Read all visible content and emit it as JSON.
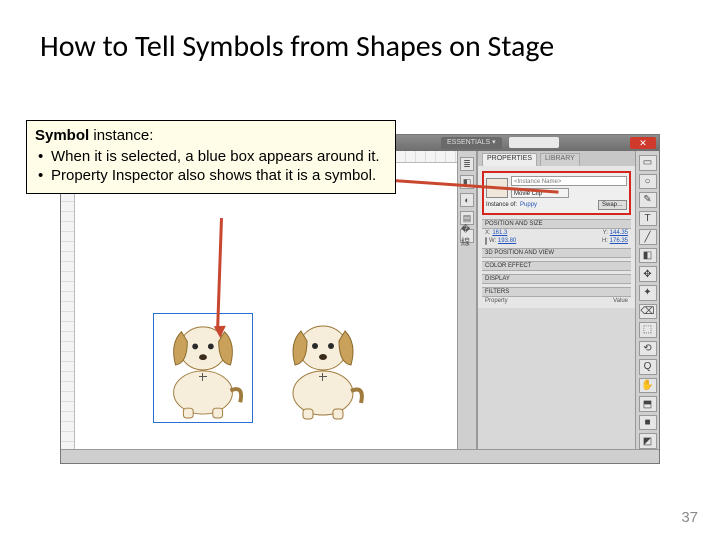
{
  "title": "How to Tell Symbols from Shapes on Stage",
  "callout": {
    "lead_bold": "Symbol",
    "lead_rest": " instance:",
    "bullets": [
      "When it is selected, a blue box appears around it.",
      "Property Inspector also shows that it is a symbol."
    ]
  },
  "flash": {
    "workspace_label": "ESSENTIALS ▾",
    "search_placeholder": "",
    "win_close": "✕",
    "tabs": {
      "properties": "PROPERTIES",
      "library": "LIBRARY"
    },
    "inspector": {
      "instance_name_placeholder": "<Instance Name>",
      "type": "Movie Clip",
      "instance_of_label": "Instance of:",
      "instance_of_value": "Puppy",
      "swap_button": "Swap…",
      "pos_size_header": "POSITION AND SIZE",
      "x_label": "X:",
      "x_value": "161.3",
      "y_label": "Y:",
      "y_value": "144.35",
      "w_label": "W:",
      "w_value": "193.80",
      "h_label": "H:",
      "h_value": "176.35",
      "threed_header": "3D POSITION AND VIEW",
      "color_header": "COLOR EFFECT",
      "display_header": "DISPLAY",
      "filters_header": "FILTERS",
      "filters_col1": "Property",
      "filters_col2": "Value"
    },
    "tools": [
      "▭",
      "○",
      "✎",
      "T",
      "╱",
      "◧",
      "✥",
      "✦",
      "⌫",
      "⬚",
      "⟲",
      "Q",
      "✋",
      "⬒",
      "■",
      "◩"
    ],
    "dock": [
      "≣",
      "◧",
      "◐",
      "▤",
      "�線"
    ]
  },
  "page_number": "37"
}
